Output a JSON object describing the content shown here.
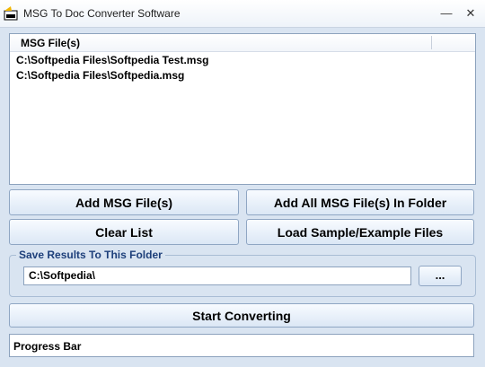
{
  "window": {
    "title": "MSG To Doc Converter Software",
    "minimize_icon": "minimize-icon",
    "close_icon": "close-icon",
    "app_icon": "app-icon"
  },
  "file_list": {
    "column_header": "MSG File(s)",
    "items": [
      "C:\\Softpedia Files\\Softpedia Test.msg",
      "C:\\Softpedia Files\\Softpedia.msg"
    ]
  },
  "buttons": {
    "add_msg_files": "Add MSG File(s)",
    "add_all_in_folder": "Add All MSG File(s) In Folder",
    "clear_list": "Clear List",
    "load_sample": "Load Sample/Example Files",
    "start_converting": "Start Converting",
    "browse": "..."
  },
  "output": {
    "group_label": "Save Results To This Folder",
    "folder_value": "C:\\Softpedia\\"
  },
  "progress": {
    "label": "Progress Bar"
  }
}
